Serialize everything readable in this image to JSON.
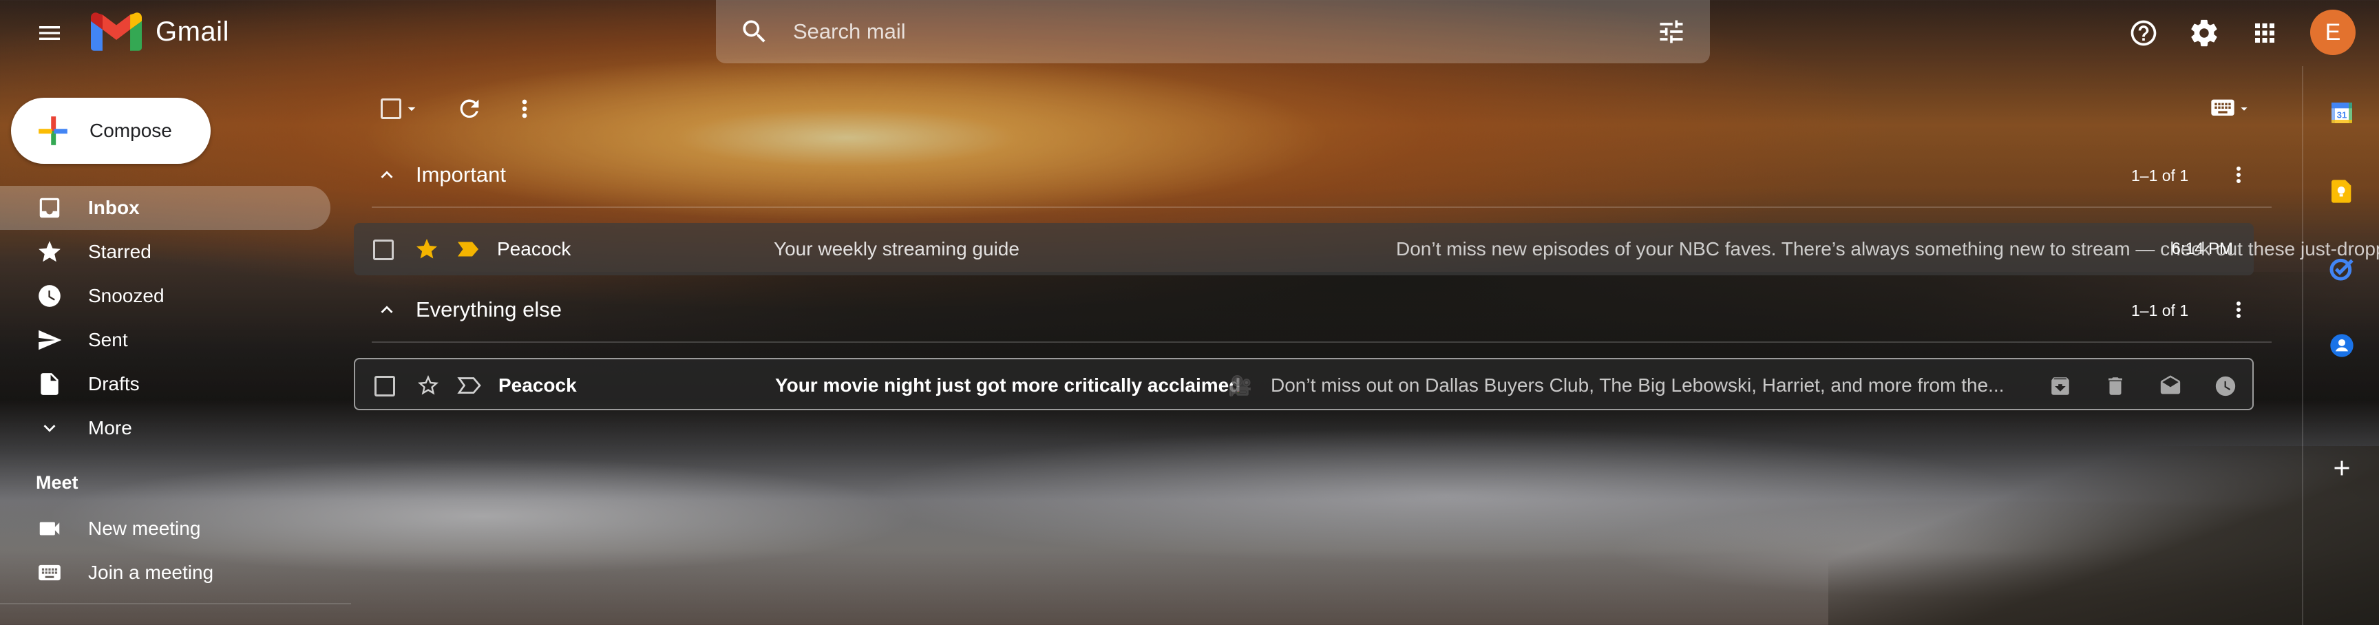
{
  "header": {
    "app_name": "Gmail",
    "search_placeholder": "Search mail",
    "avatar_initial": "E"
  },
  "sidebar": {
    "compose_label": "Compose",
    "items": [
      {
        "label": "Inbox",
        "icon": "inbox-icon",
        "active": true
      },
      {
        "label": "Starred",
        "icon": "star-icon"
      },
      {
        "label": "Snoozed",
        "icon": "clock-icon"
      },
      {
        "label": "Sent",
        "icon": "send-icon"
      },
      {
        "label": "Drafts",
        "icon": "draft-icon"
      },
      {
        "label": "More",
        "icon": "chevron-down-icon"
      }
    ],
    "meet": {
      "title": "Meet",
      "items": [
        {
          "label": "New meeting",
          "icon": "video-icon"
        },
        {
          "label": "Join a meeting",
          "icon": "keyboard-icon"
        }
      ]
    }
  },
  "sections": [
    {
      "title": "Important",
      "count": "1–1 of 1",
      "emails": [
        {
          "sender": "Peacock",
          "subject": "Your weekly streaming guide",
          "separator": " - ",
          "snippet": "Don’t miss new episodes of your NBC faves. There’s always something new to stream — check out these just-dropped p...",
          "time": "6:14 PM",
          "starred": true,
          "important": true
        }
      ]
    },
    {
      "title": "Everything else",
      "count": "1–1 of 1",
      "emails": [
        {
          "sender": "Peacock",
          "subject": "Your movie night just got more critically acclaimed",
          "separator": " 🎥 ",
          "snippet": "Don’t miss out on Dallas Buyers Club, The Big Lebowski, Harriet, and more from the...",
          "starred": false,
          "important": false,
          "unread": true
        }
      ]
    }
  ],
  "colors": {
    "avatar": "#e3722e",
    "star": "#f4b400",
    "important_marker": "#f4b400"
  }
}
